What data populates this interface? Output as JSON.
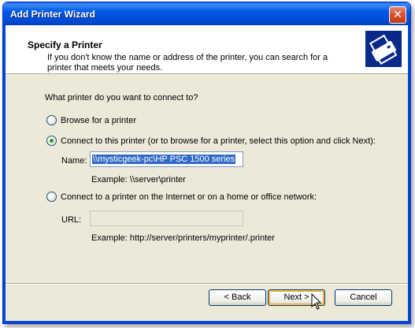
{
  "window": {
    "title": "Add Printer Wizard",
    "close_glyph": "✕"
  },
  "header": {
    "title": "Specify a Printer",
    "description": "If you don't know the name or address of the printer, you can search for a printer that meets your needs.",
    "icon": "printer-icon"
  },
  "form": {
    "question": "What printer do you want to connect to?",
    "options": [
      {
        "label": "Browse for a printer",
        "checked": false
      },
      {
        "label": "Connect to this printer (or to browse for a printer, select this option and click Next):",
        "checked": true
      },
      {
        "label": "Connect to a printer on the Internet or on a home or office network:",
        "checked": false
      }
    ],
    "name_label": "Name:",
    "name_value": "\\\\mysticgeek-pc\\HP PSC 1500 series",
    "name_example": "Example: \\\\server\\printer",
    "url_label": "URL:",
    "url_value": "",
    "url_example": "Example: http://server/printers/myprinter/.printer"
  },
  "buttons": {
    "back": "< Back",
    "next": "Next >",
    "cancel": "Cancel"
  },
  "colors": {
    "title_bar": "#0058e6",
    "dialog_bg": "#ece9d8",
    "selection": "#316ac5",
    "radio_dot": "#21a121"
  }
}
